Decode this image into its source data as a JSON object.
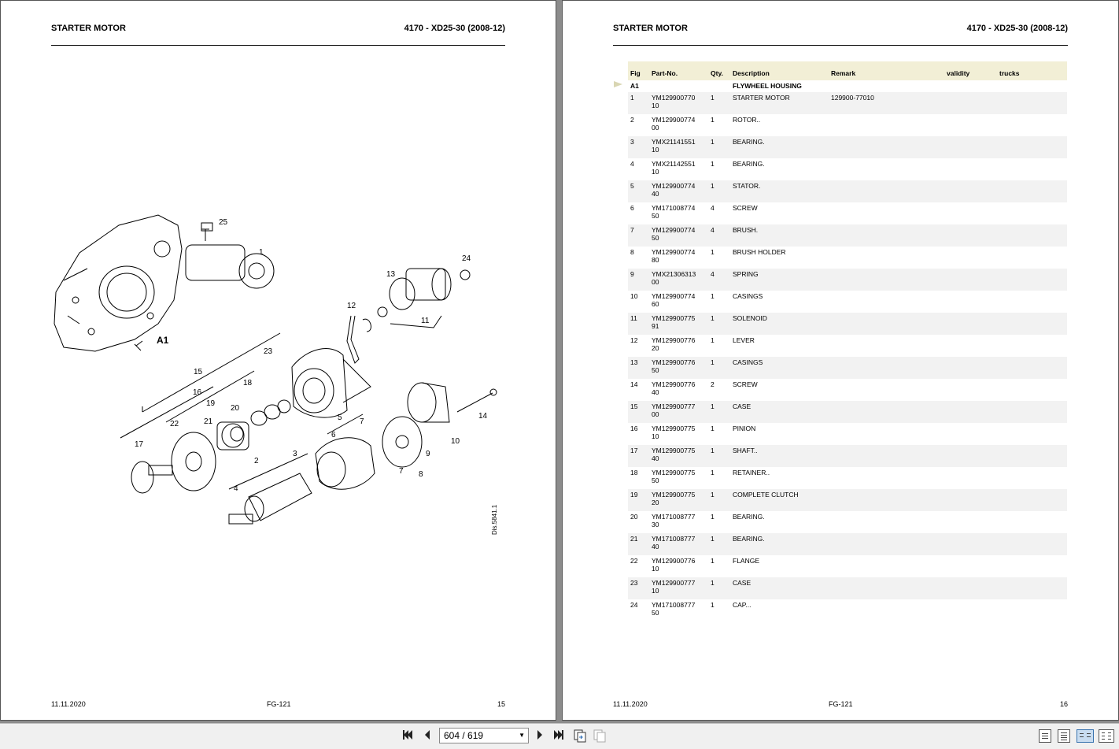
{
  "left_page": {
    "title": "STARTER MOTOR",
    "model": "4170 - XD25-30 (2008-12)",
    "footer_date": "11.11.2020",
    "footer_code": "FG-121",
    "footer_page": "15",
    "diagram": {
      "callouts": [
        "25",
        "1",
        "24",
        "13",
        "12",
        "11",
        "A1",
        "23",
        "15",
        "18",
        "16",
        "19",
        "20",
        "22",
        "21",
        "5",
        "6",
        "7",
        "14",
        "17",
        "9",
        "10",
        "2",
        "3",
        "7",
        "8",
        "4"
      ],
      "drawing_ref": "Dis.5841.1"
    }
  },
  "right_page": {
    "title": "STARTER MOTOR",
    "model": "4170 - XD25-30 (2008-12)",
    "footer_date": "11.11.2020",
    "footer_code": "FG-121",
    "footer_page": "16",
    "table_headers": {
      "fig": "Fig",
      "part_no": "Part-No.",
      "qty": "Qty.",
      "description": "Description",
      "remark": "Remark",
      "validity": "validity",
      "trucks": "trucks"
    },
    "group": {
      "fig": "A1",
      "description": "FLYWHEEL HOUSING"
    },
    "rows": [
      {
        "fig": "1",
        "pn1": "YM129900770",
        "pn2": "10",
        "qty": "1",
        "desc": "STARTER MOTOR",
        "remark": "129900-77010"
      },
      {
        "fig": "2",
        "pn1": "YM129900774",
        "pn2": "00",
        "qty": "1",
        "desc": "ROTOR..",
        "remark": ""
      },
      {
        "fig": "3",
        "pn1": "YMX21141551",
        "pn2": "10",
        "qty": "1",
        "desc": "BEARING.",
        "remark": ""
      },
      {
        "fig": "4",
        "pn1": "YMX21142551",
        "pn2": "10",
        "qty": "1",
        "desc": "BEARING.",
        "remark": ""
      },
      {
        "fig": "5",
        "pn1": "YM129900774",
        "pn2": "40",
        "qty": "1",
        "desc": "STATOR.",
        "remark": ""
      },
      {
        "fig": "6",
        "pn1": "YM171008774",
        "pn2": "50",
        "qty": "4",
        "desc": "SCREW",
        "remark": ""
      },
      {
        "fig": "7",
        "pn1": "YM129900774",
        "pn2": "50",
        "qty": "4",
        "desc": "BRUSH.",
        "remark": ""
      },
      {
        "fig": "8",
        "pn1": "YM129900774",
        "pn2": "80",
        "qty": "1",
        "desc": "BRUSH HOLDER",
        "remark": ""
      },
      {
        "fig": "9",
        "pn1": "YMX21306313",
        "pn2": "00",
        "qty": "4",
        "desc": "SPRING",
        "remark": ""
      },
      {
        "fig": "10",
        "pn1": "YM129900774",
        "pn2": "60",
        "qty": "1",
        "desc": "CASINGS",
        "remark": ""
      },
      {
        "fig": "11",
        "pn1": "YM129900775",
        "pn2": "91",
        "qty": "1",
        "desc": "SOLENOID",
        "remark": ""
      },
      {
        "fig": "12",
        "pn1": "YM129900776",
        "pn2": "20",
        "qty": "1",
        "desc": "LEVER",
        "remark": ""
      },
      {
        "fig": "13",
        "pn1": "YM129900776",
        "pn2": "50",
        "qty": "1",
        "desc": "CASINGS",
        "remark": ""
      },
      {
        "fig": "14",
        "pn1": "YM129900776",
        "pn2": "40",
        "qty": "2",
        "desc": "SCREW",
        "remark": ""
      },
      {
        "fig": "15",
        "pn1": "YM129900777",
        "pn2": "00",
        "qty": "1",
        "desc": "CASE",
        "remark": ""
      },
      {
        "fig": "16",
        "pn1": "YM129900775",
        "pn2": "10",
        "qty": "1",
        "desc": "PINION",
        "remark": ""
      },
      {
        "fig": "17",
        "pn1": "YM129900775",
        "pn2": "40",
        "qty": "1",
        "desc": "SHAFT..",
        "remark": ""
      },
      {
        "fig": "18",
        "pn1": "YM129900775",
        "pn2": "50",
        "qty": "1",
        "desc": "RETAINER..",
        "remark": ""
      },
      {
        "fig": "19",
        "pn1": "YM129900775",
        "pn2": "20",
        "qty": "1",
        "desc": "COMPLETE CLUTCH",
        "remark": ""
      },
      {
        "fig": "20",
        "pn1": "YM171008777",
        "pn2": "30",
        "qty": "1",
        "desc": "BEARING.",
        "remark": ""
      },
      {
        "fig": "21",
        "pn1": "YM171008777",
        "pn2": "40",
        "qty": "1",
        "desc": "BEARING.",
        "remark": ""
      },
      {
        "fig": "22",
        "pn1": "YM129900776",
        "pn2": "10",
        "qty": "1",
        "desc": "FLANGE",
        "remark": ""
      },
      {
        "fig": "23",
        "pn1": "YM129900777",
        "pn2": "10",
        "qty": "1",
        "desc": "CASE",
        "remark": ""
      },
      {
        "fig": "24",
        "pn1": "YM171008777",
        "pn2": "50",
        "qty": "1",
        "desc": "CAP...",
        "remark": ""
      }
    ]
  },
  "toolbar": {
    "page_indicator": "604 / 619",
    "icons": [
      "first-page-icon",
      "prev-page-icon",
      "next-page-icon",
      "last-page-icon",
      "copy-icon",
      "copy-disabled-icon",
      "single-page-view-icon",
      "continuous-view-icon",
      "two-page-view-icon",
      "two-page-continuous-view-icon"
    ]
  }
}
